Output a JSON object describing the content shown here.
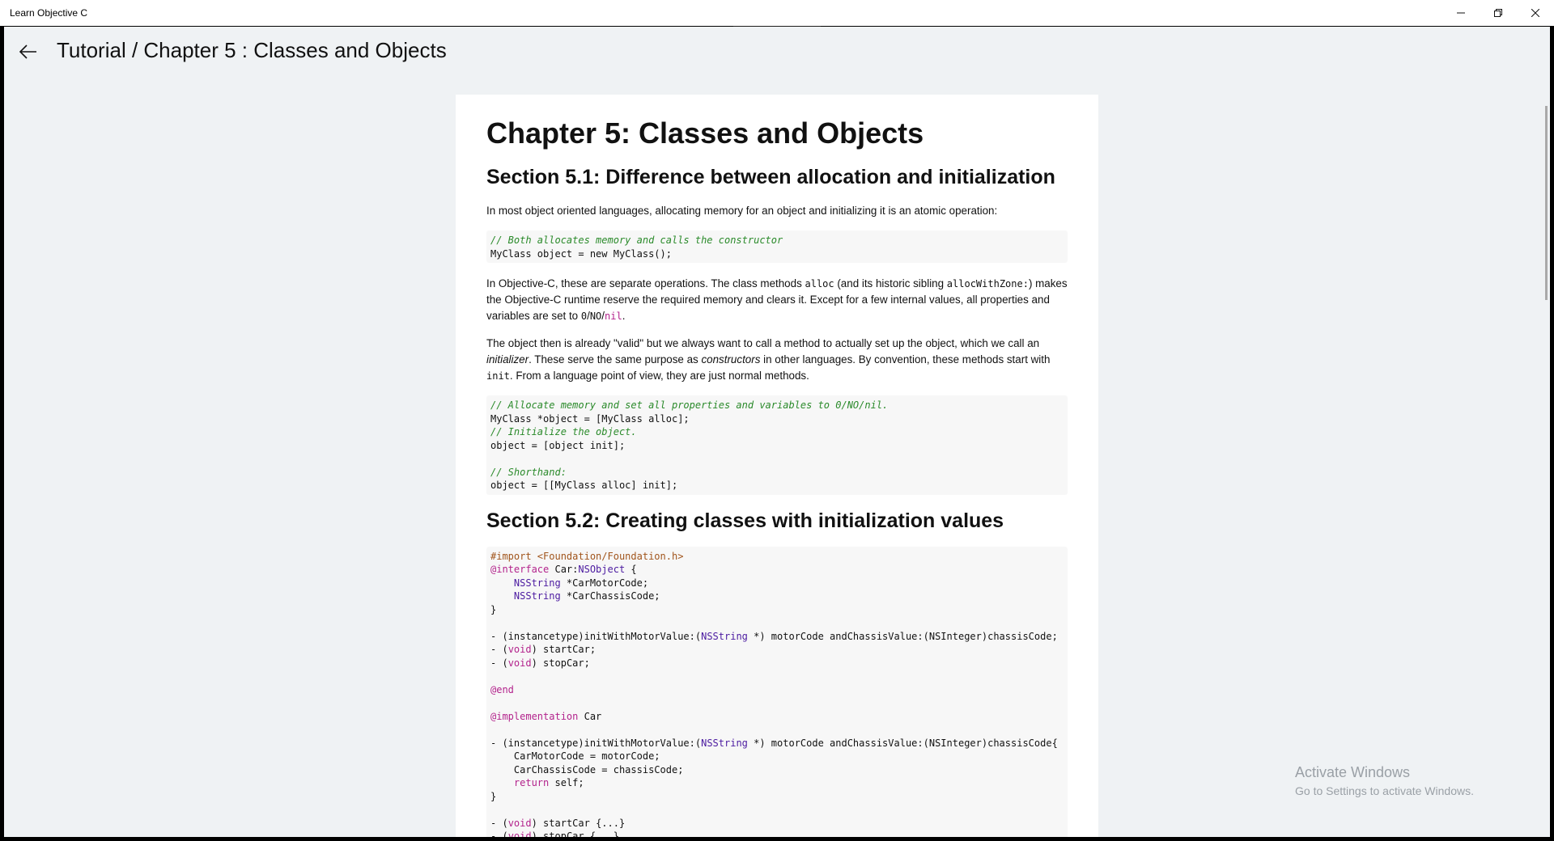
{
  "app_title": "Learn Objective C",
  "breadcrumb": "Tutorial / Chapter 5 :  Classes and Objects",
  "watermark": {
    "title": "Activate Windows",
    "subtitle": "Go to Settings to activate Windows."
  },
  "doc": {
    "chapter_title": "Chapter 5: Classes and Objects",
    "sec1_title": "Section 5.1: Difference between allocation and initialization",
    "p1": "In most object oriented languages, allocating memory for an object and initializing it is an atomic operation:",
    "code1": [
      "// Both allocates memory and calls the constructor",
      "MyClass object = new MyClass();"
    ],
    "p2": {
      "a": "In Objective-C, these are separate operations. The class methods ",
      "alloc": "alloc",
      "b": " (and its historic sibling ",
      "allocWithZone": "allocWithZone:",
      "c": ") makes the Objective-C runtime reserve the required memory and clears it. Except for a few internal values, all properties and variables are set to ",
      "zero": "0",
      "no": "NO",
      "nil": "nil",
      "d": "."
    },
    "p3": {
      "a": "The object then is already \"valid\" but we always want to call a method to actually set up the object, which we call an ",
      "initializer": "initializer",
      "b": ". These serve the same purpose as ",
      "constructors": "constructors",
      "c": " in other languages. By convention, these methods start with ",
      "init": "init",
      "d": ". From a language point of view, they are just normal methods."
    },
    "code2": [
      "// Allocate memory and set all properties and variables to 0/NO/nil.",
      "MyClass *object = [MyClass alloc];",
      "// Initialize the object.",
      "object = [object init];",
      "",
      "// Shorthand:",
      "object = [[MyClass alloc] init];"
    ],
    "sec2_title": "Section 5.2: Creating classes with initialization values",
    "code3": {
      "import": "#import <Foundation/Foundation.h>",
      "interface": "@interface",
      "car_nsobject": " Car:",
      "nsobject": "NSObject",
      "brace_open": " {",
      "nsstring": "NSString",
      "motor_decl": " *CarMotorCode;",
      "chassis_decl": " *CarChassisCode;",
      "brace_close": "}",
      "m1_a": "- (instancetype)initWithMotorValue:(",
      "m1_b": " *) motorCode andChassisValue:(NSInteger)chassisCode;",
      "m2_a": "- (",
      "void": "void",
      "m2_b": ") startCar;",
      "m3_b": ") stopCar;",
      "end": "@end",
      "implementation": "@implementation",
      "impl_car": " Car",
      "m4_b": " *) motorCode andChassisValue:(NSInteger)chassisCode{",
      "assign1": "    CarMotorCode = motorCode;",
      "assign2": "    CarChassisCode = chassisCode;",
      "return": "return",
      "return_self": " self;",
      "start_body": ") startCar {...}",
      "stop_body": ") stopCar {...}"
    }
  }
}
